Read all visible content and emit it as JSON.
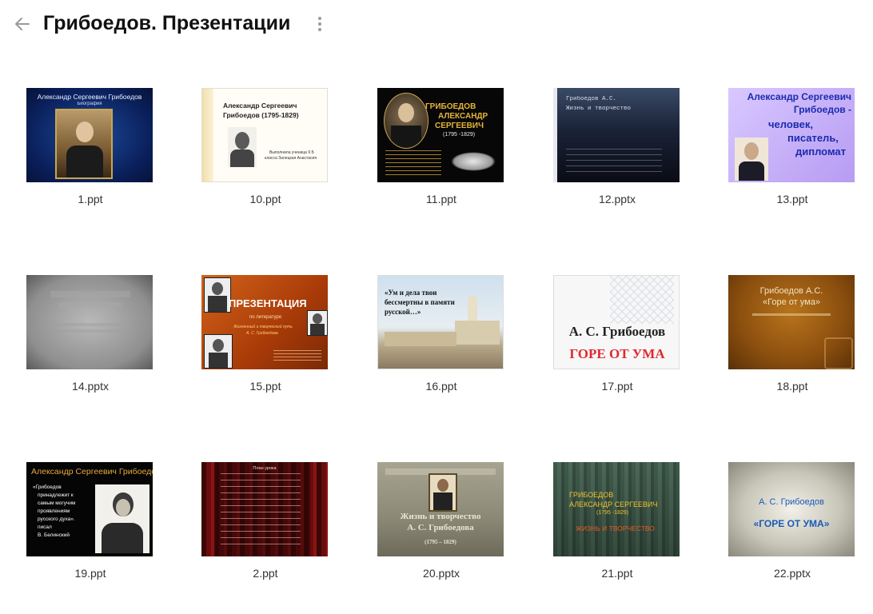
{
  "header": {
    "title": "Грибоедов. Презентации",
    "back_icon": "arrow-left-icon",
    "more_icon": "more-vertical-icon"
  },
  "files": [
    {
      "name": "1.ppt",
      "slide": {
        "line1": "Александр Сергеевич Грибоедов",
        "line2": "Биография"
      }
    },
    {
      "name": "10.ppt",
      "slide": {
        "line1": "Александр Сергеевич",
        "line2": "Грибоедов (1795-1829)",
        "line3": "Выполнила ученица 9 Б",
        "line4": "класса Залецкая Анастасия"
      }
    },
    {
      "name": "11.ppt",
      "slide": {
        "line1": "ГРИБОЕДОВ",
        "line2": "АЛЕКСАНДР",
        "line3": "СЕРГЕЕВИЧ",
        "line4": "(1795 -1829)"
      }
    },
    {
      "name": "12.pptx",
      "slide": {
        "line1": "Грибоедов А.С.",
        "line2": "Жизнь и творчество"
      }
    },
    {
      "name": "13.ppt",
      "slide": {
        "line1": "Александр Сергеевич",
        "line2": "Грибоедов -",
        "line3": "человек,",
        "line4": "писатель,",
        "line5": "дипломат"
      }
    },
    {
      "name": "14.pptx",
      "slide": {}
    },
    {
      "name": "15.ppt",
      "slide": {
        "line1": "ПРЕЗЕНТАЦИЯ",
        "line2": "по литературе",
        "line3": "Жизненный и творческий путь",
        "line4": "А. С. Грибоедова"
      }
    },
    {
      "name": "16.ppt",
      "slide": {
        "line1": "«Ум и дела твои",
        "line2": "бессмертны в памяти",
        "line3": "русской…»"
      }
    },
    {
      "name": "17.ppt",
      "slide": {
        "line1": "А. С. Грибоедов",
        "line2": "ГОРЕ ОТ УМА"
      }
    },
    {
      "name": "18.ppt",
      "slide": {
        "line1": "Грибоедов А.С.",
        "line2": "«Горе от ума»"
      }
    },
    {
      "name": "19.ppt",
      "slide": {
        "line1": "Александр Сергеевич Грибоедов",
        "line2": "«Грибоедов",
        "line3": "принадлежит к",
        "line4": "самым могучим",
        "line5": "проявлениям",
        "line6": "русского духа».",
        "line7": "писал",
        "line8": "В. Белинский"
      }
    },
    {
      "name": "2.ppt",
      "slide": {
        "line1": "План урока"
      }
    },
    {
      "name": "20.pptx",
      "slide": {
        "line1": "Жизнь и творчество",
        "line2": "А. С. Грибоедова",
        "line3": "(1795 – 1829)"
      }
    },
    {
      "name": "21.ppt",
      "slide": {
        "line1": "ГРИБОЕДОВ",
        "line2": "АЛЕКСАНДР СЕРГЕЕВИЧ",
        "line3": "(1795 -1829)",
        "line4": "ЖИЗНЬ И ТВОРЧЕСТВО"
      }
    },
    {
      "name": "22.pptx",
      "slide": {
        "line1": "А. С. Грибоедов",
        "line2": "«ГОРЕ ОТ УМА»"
      }
    }
  ],
  "colors": {
    "background": "#ffffff",
    "title": "#111111",
    "icon": "#9a9a9a"
  }
}
